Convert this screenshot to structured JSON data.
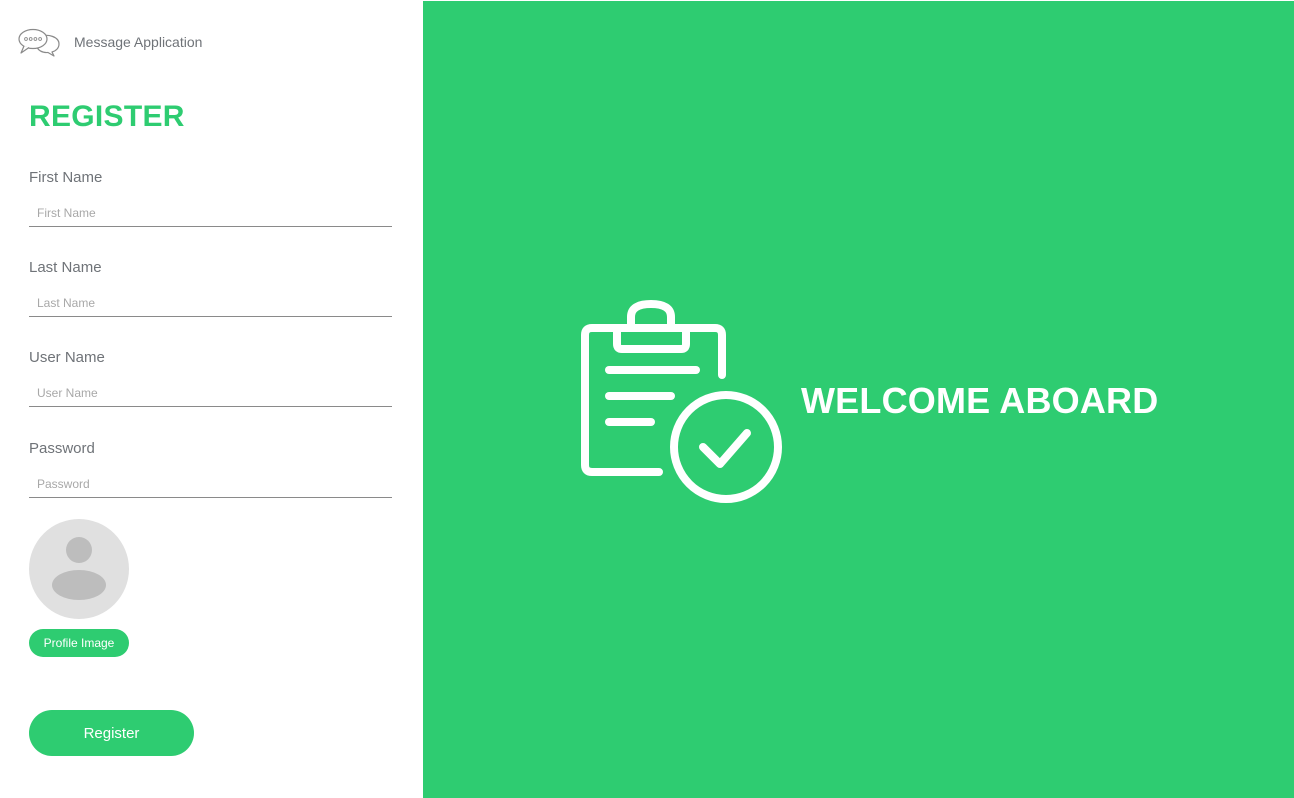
{
  "app": {
    "title": "Message Application",
    "brand_icon": "chat-bubbles-icon"
  },
  "form": {
    "heading": "REGISTER",
    "fields": [
      {
        "label": "First Name",
        "placeholder": "First Name",
        "value": ""
      },
      {
        "label": "Last Name",
        "placeholder": "Last Name",
        "value": ""
      },
      {
        "label": "User Name",
        "placeholder": "User Name",
        "value": ""
      },
      {
        "label": "Password",
        "placeholder": "Password",
        "value": ""
      }
    ],
    "avatar_icon": "user-avatar-icon",
    "profile_button_label": "Profile Image",
    "register_button_label": "Register"
  },
  "welcome": {
    "text": "WELCOME ABOARD",
    "icon": "clipboard-check-icon"
  },
  "colors": {
    "accent": "#2ecc71",
    "panel": "#2ecc71",
    "label": "#6f7378",
    "avatar_bg": "#e0e0e0",
    "avatar_fg": "#bdbdbd"
  }
}
